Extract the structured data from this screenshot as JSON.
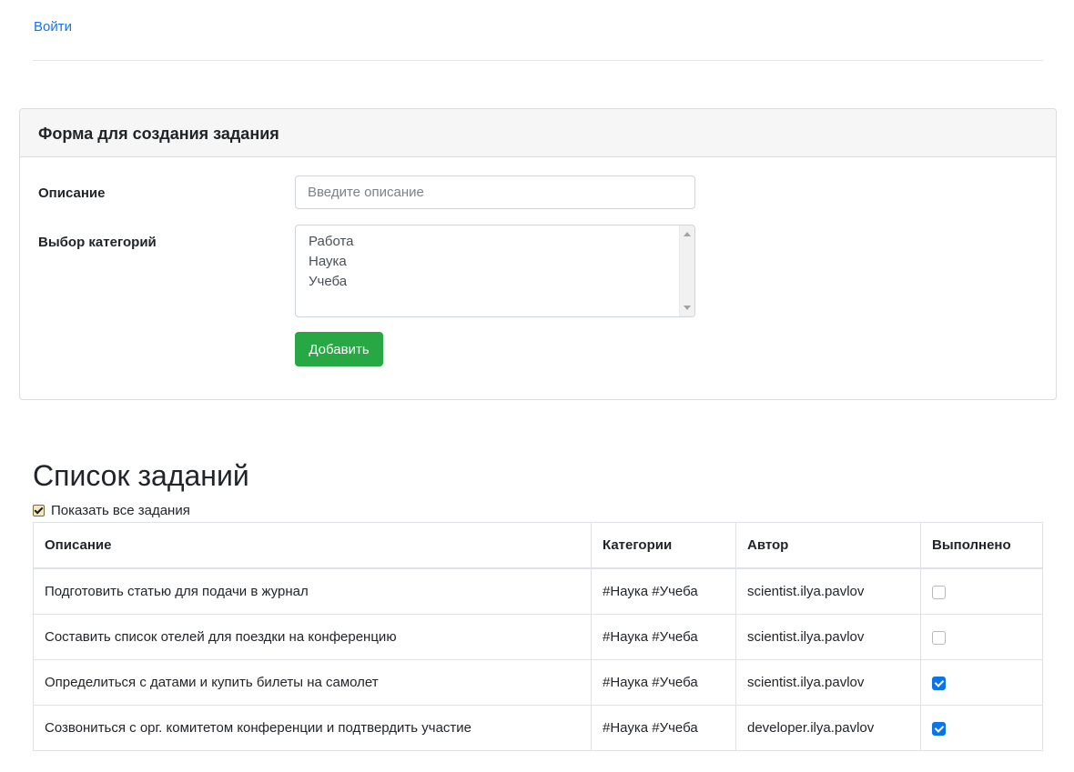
{
  "header": {
    "login_link": "Войти"
  },
  "form": {
    "title": "Форма для создания задания",
    "description_label": "Описание",
    "description_placeholder": "Введите описание",
    "description_value": "",
    "categories_label": "Выбор категорий",
    "categories": [
      "Работа",
      "Наука",
      "Учеба"
    ],
    "add_button": "Добавить"
  },
  "task_list": {
    "title": "Список заданий",
    "show_all_label": "Показать все задания",
    "show_all_checked": true,
    "columns": [
      "Описание",
      "Категории",
      "Автор",
      "Выполнено"
    ],
    "rows": [
      {
        "description": "Подготовить статью для подачи в журнал",
        "categories": "#Наука #Учеба",
        "author": "scientist.ilya.pavlov",
        "done": false
      },
      {
        "description": "Составить список отелей для поездки на конференцию",
        "categories": "#Наука #Учеба",
        "author": "scientist.ilya.pavlov",
        "done": false
      },
      {
        "description": "Определиться с датами и купить билеты на самолет",
        "categories": "#Наука #Учеба",
        "author": "scientist.ilya.pavlov",
        "done": true
      },
      {
        "description": "Созвониться с орг. комитетом конференции и подтвердить участие",
        "categories": "#Наука #Учеба",
        "author": "developer.ilya.pavlov",
        "done": true
      }
    ]
  },
  "colors": {
    "link": "#1a73e8",
    "success_button": "#28a745",
    "checkbox_checked": "#0b74e6"
  }
}
